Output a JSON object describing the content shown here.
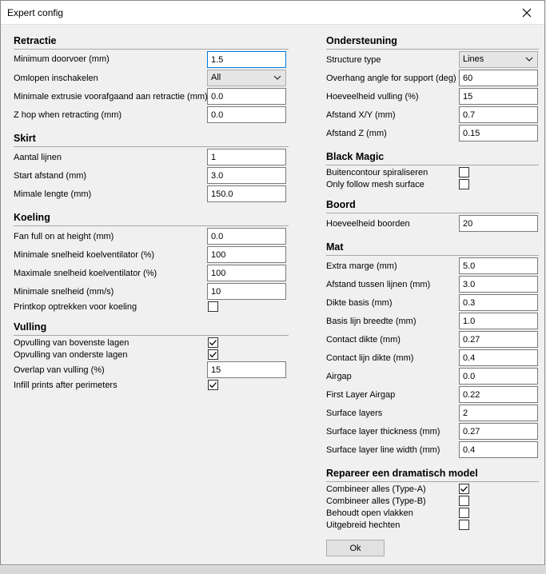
{
  "window": {
    "title": "Expert config"
  },
  "left": {
    "retractie": {
      "title": "Retractie",
      "min_doorvoer": {
        "label": "Minimum doorvoer (mm)",
        "value": "1.5"
      },
      "omlopen": {
        "label": "Omlopen inschakelen",
        "value": "All"
      },
      "min_extrusie": {
        "label": "Minimale extrusie voorafgaand aan retractie (mm)",
        "value": "0.0"
      },
      "z_hop": {
        "label": "Z hop when retracting (mm)",
        "value": "0.0"
      }
    },
    "skirt": {
      "title": "Skirt",
      "aantal_lijnen": {
        "label": "Aantal lijnen",
        "value": "1"
      },
      "start_afstand": {
        "label": "Start afstand (mm)",
        "value": "3.0"
      },
      "mimale_lengte": {
        "label": "Mimale lengte (mm)",
        "value": "150.0"
      }
    },
    "koeling": {
      "title": "Koeling",
      "fan_full": {
        "label": "Fan full on at height (mm)",
        "value": "0.0"
      },
      "min_snelheid_fan": {
        "label": "Minimale snelheid koelventilator (%)",
        "value": "100"
      },
      "max_snelheid_fan": {
        "label": "Maximale snelheid koelventilator (%)",
        "value": "100"
      },
      "min_snelheid": {
        "label": "Minimale snelheid (mm/s)",
        "value": "10"
      },
      "printkop": {
        "label": "Printkop optrekken voor koeling",
        "checked": false
      }
    },
    "vulling": {
      "title": "Vulling",
      "bovenste": {
        "label": "Opvulling van bovenste lagen",
        "checked": true
      },
      "onderste": {
        "label": "Opvulling van onderste lagen",
        "checked": true
      },
      "overlap": {
        "label": "Overlap van vulling (%)",
        "value": "15"
      },
      "infill_after": {
        "label": "Infill prints after perimeters",
        "checked": true
      }
    }
  },
  "right": {
    "ondersteuning": {
      "title": "Ondersteuning",
      "structure_type": {
        "label": "Structure type",
        "value": "Lines"
      },
      "overhang": {
        "label": "Overhang angle for support (deg)",
        "value": "60"
      },
      "vulling": {
        "label": "Hoeveelheid vulling (%)",
        "value": "15"
      },
      "afstand_xy": {
        "label": "Afstand X/Y (mm)",
        "value": "0.7"
      },
      "afstand_z": {
        "label": "Afstand Z (mm)",
        "value": "0.15"
      }
    },
    "black_magic": {
      "title": "Black Magic",
      "spiraliseren": {
        "label": "Buitencontour spiraliseren",
        "checked": false
      },
      "mesh_surface": {
        "label": "Only follow mesh surface",
        "checked": false
      }
    },
    "boord": {
      "title": "Boord",
      "hoeveelheid": {
        "label": "Hoeveelheid boorden",
        "value": "20"
      }
    },
    "mat": {
      "title": "Mat",
      "extra_marge": {
        "label": "Extra marge (mm)",
        "value": "5.0"
      },
      "afstand_lijnen": {
        "label": "Afstand tussen lijnen (mm)",
        "value": "3.0"
      },
      "dikte_basis": {
        "label": "Dikte basis (mm)",
        "value": "0.3"
      },
      "basis_lijn": {
        "label": "Basis lijn breedte (mm)",
        "value": "1.0"
      },
      "contact_dikte": {
        "label": "Contact dikte (mm)",
        "value": "0.27"
      },
      "contact_lijn": {
        "label": "Contact lijn dikte (mm)",
        "value": "0.4"
      },
      "airgap": {
        "label": "Airgap",
        "value": "0.0"
      },
      "first_layer_airgap": {
        "label": "First Layer Airgap",
        "value": "0.22"
      },
      "surface_layers": {
        "label": "Surface layers",
        "value": "2"
      },
      "surface_thickness": {
        "label": "Surface layer thickness (mm)",
        "value": "0.27"
      },
      "surface_width": {
        "label": "Surface layer line width (mm)",
        "value": "0.4"
      }
    },
    "repareer": {
      "title": "Repareer een dramatisch model",
      "type_a": {
        "label": "Combineer alles (Type-A)",
        "checked": true
      },
      "type_b": {
        "label": "Combineer alles (Type-B)",
        "checked": false
      },
      "open_vlakken": {
        "label": "Behoudt open vlakken",
        "checked": false
      },
      "uitgebreid": {
        "label": "Uitgebreid hechten",
        "checked": false
      }
    }
  },
  "ok_label": "Ok",
  "icons": {
    "close": "close-icon",
    "dropdown": "chevron-down-icon",
    "check": "checkmark-icon"
  }
}
